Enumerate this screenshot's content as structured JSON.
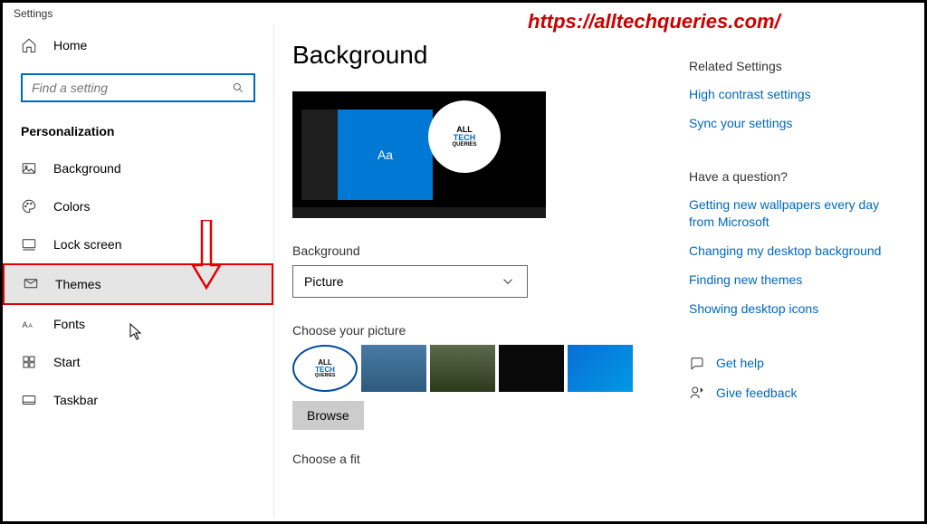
{
  "window_title": "Settings",
  "overlay_url": "https://alltechqueries.com/",
  "sidebar": {
    "home_label": "Home",
    "search_placeholder": "Find a setting",
    "category": "Personalization",
    "items": [
      {
        "label": "Background",
        "icon": "image"
      },
      {
        "label": "Colors",
        "icon": "palette"
      },
      {
        "label": "Lock screen",
        "icon": "lock"
      },
      {
        "label": "Themes",
        "icon": "themes",
        "selected": true
      },
      {
        "label": "Fonts",
        "icon": "fonts"
      },
      {
        "label": "Start",
        "icon": "start"
      },
      {
        "label": "Taskbar",
        "icon": "taskbar"
      }
    ]
  },
  "main": {
    "title": "Background",
    "preview_sample": "Aa",
    "bg_label": "Background",
    "bg_value": "Picture",
    "choose_label": "Choose your picture",
    "browse_label": "Browse",
    "fit_label": "Choose a fit"
  },
  "right": {
    "related_heading": "Related Settings",
    "related_links": [
      "High contrast settings",
      "Sync your settings"
    ],
    "question_heading": "Have a question?",
    "question_links": [
      "Getting new wallpapers every day from Microsoft",
      "Changing my desktop background",
      "Finding new themes",
      "Showing desktop icons"
    ],
    "help_label": "Get help",
    "feedback_label": "Give feedback"
  }
}
